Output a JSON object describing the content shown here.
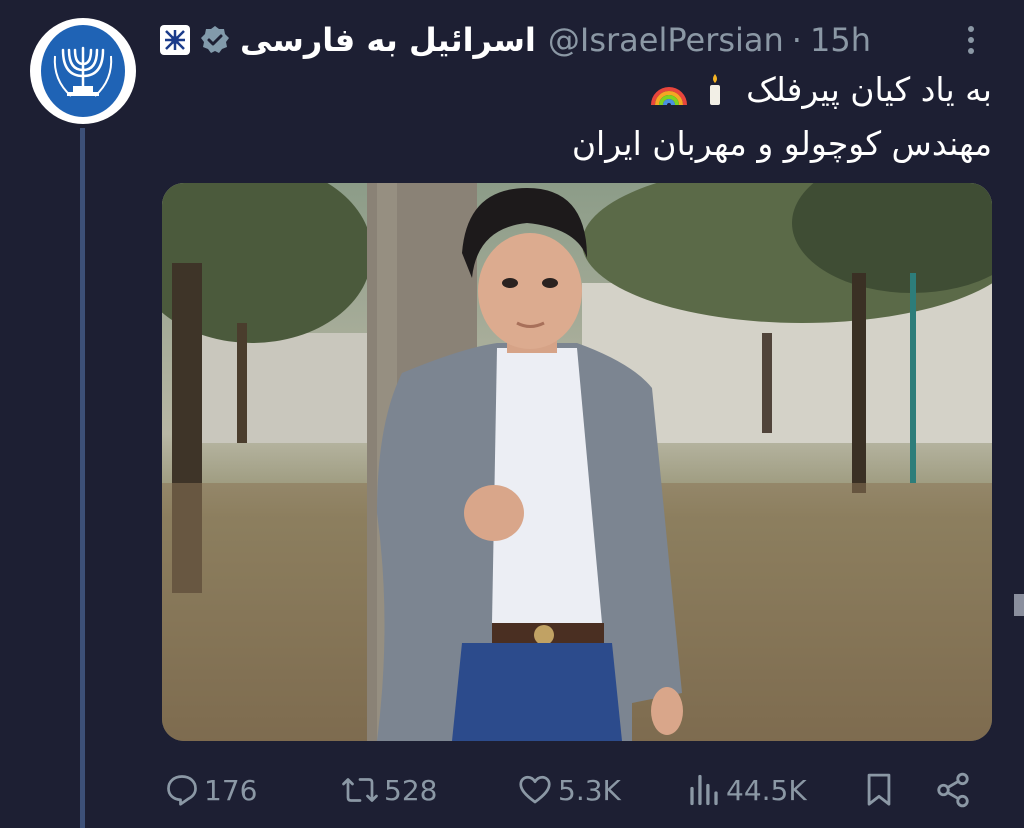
{
  "tweet": {
    "display_name": "اسرائیل به فارسی",
    "handle": "@IsraelPersian",
    "separator": "·",
    "time": "15h",
    "text_line1": "به یاد کیان پیرفلک",
    "text_line2": "مهندس کوچولو و مهربان ایران",
    "emojis": [
      "candle-emoji",
      "rainbow-emoji"
    ],
    "media_alt": "photo of a boy in a grey blazer leaning on a tree in a park"
  },
  "actions": {
    "replies": "176",
    "retweets": "528",
    "likes": "5.3K",
    "views": "44.5K"
  },
  "icons": {
    "verified": "verified-badge-icon",
    "more": "more-options-icon",
    "reply": "reply-icon",
    "retweet": "retweet-icon",
    "like": "heart-icon",
    "views": "views-chart-icon",
    "bookmark": "bookmark-icon",
    "share": "share-icon"
  },
  "colors": {
    "background": "#1d1f33",
    "muted_text": "#8b98a5",
    "avatar_blue": "#1f63b5"
  }
}
